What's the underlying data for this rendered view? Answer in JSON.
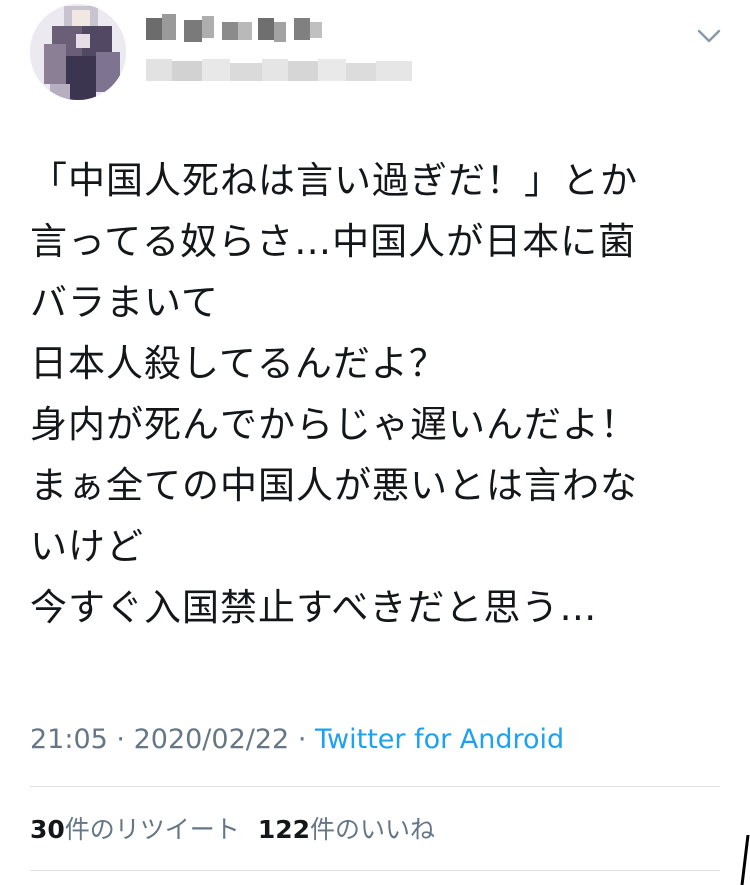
{
  "tweet": {
    "lines": [
      "「中国人死ねは言い過ぎだ！」とか",
      "言ってる奴らさ…中国人が日本に菌",
      "バラまいて",
      "日本人殺してるんだよ？",
      "身内が死んでからじゃ遅いんだよ！",
      "まぁ全ての中国人が悪いとは言わな",
      "いけど",
      "今すぐ入国禁止すべきだと思う…"
    ],
    "time": "21:05",
    "date": "2020/02/22",
    "separator": "·",
    "source": "Twitter for Android"
  },
  "stats": {
    "retweet_count": "30",
    "retweet_label": "件のリツイート",
    "like_count": "122",
    "like_label": "件のいいね"
  },
  "icons": {
    "menu": "chevron-down-icon"
  },
  "colors": {
    "text": "#14171a",
    "secondary": "#657786",
    "link": "#1da1f2",
    "divider": "#dfe3e7"
  }
}
